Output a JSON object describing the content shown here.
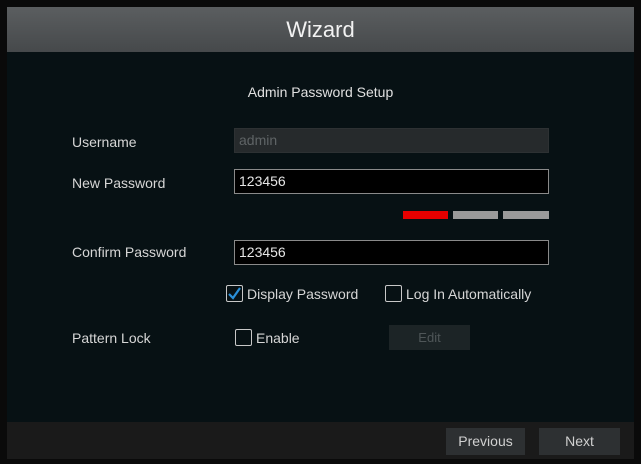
{
  "window": {
    "title": "Wizard"
  },
  "section": {
    "title": "Admin Password Setup"
  },
  "form": {
    "username": {
      "label": "Username",
      "value": "admin"
    },
    "new_password": {
      "label": "New Password",
      "value": "123456"
    },
    "password_strength": {
      "level": 1,
      "max": 3,
      "colors": {
        "filled": "#e60000",
        "empty": "#9a9a9a"
      }
    },
    "confirm_password": {
      "label": "Confirm Password",
      "value": "123456"
    },
    "display_password": {
      "label": "Display Password",
      "checked": true
    },
    "log_in_automatically": {
      "label": "Log In Automatically",
      "checked": false
    },
    "pattern_lock": {
      "label": "Pattern Lock",
      "enable_label": "Enable",
      "enabled": false,
      "edit_label": "Edit"
    }
  },
  "footer": {
    "previous_label": "Previous",
    "next_label": "Next"
  }
}
